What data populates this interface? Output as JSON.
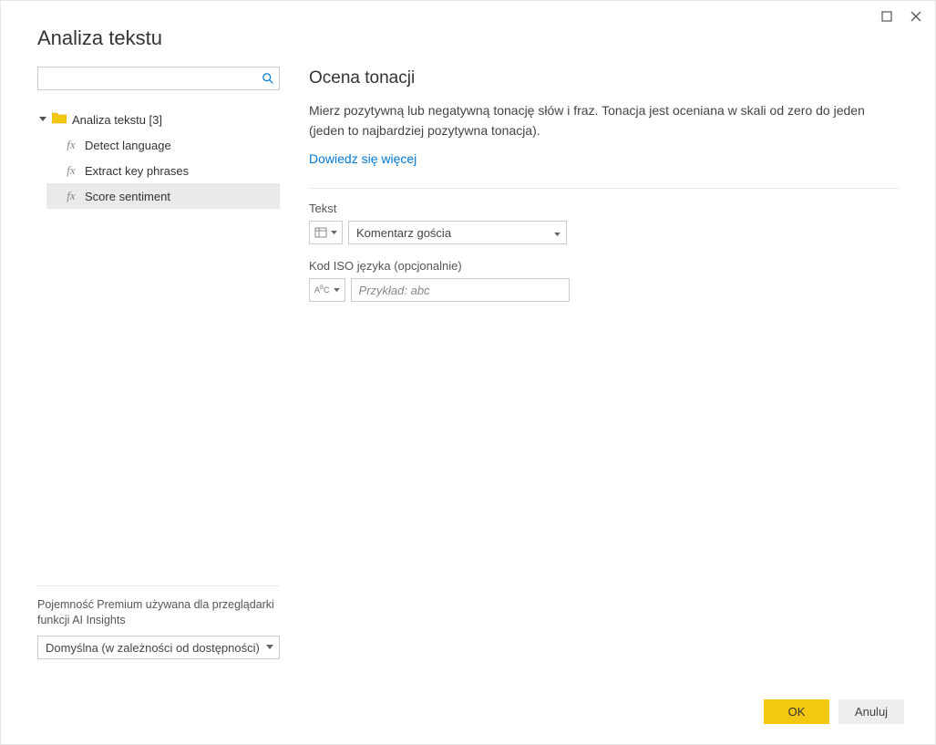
{
  "window": {
    "title": "Analiza tekstu"
  },
  "search": {
    "value": ""
  },
  "tree": {
    "root_label": "Analiza tekstu [3]",
    "items": [
      {
        "label": "Detect language",
        "selected": false
      },
      {
        "label": "Extract key phrases",
        "selected": false
      },
      {
        "label": "Score sentiment",
        "selected": true
      }
    ]
  },
  "capacity": {
    "label": "Pojemność Premium używana dla przeglądarki funkcji AI Insights",
    "value": "Domyślna (w zależności od dostępności)"
  },
  "details": {
    "heading": "Ocena tonacji",
    "description": "Mierz pozytywną lub negatywną tonację słów i fraz. Tonacja jest oceniana w skali od zero do jeden (jeden to najbardziej pozytywna tonacja).",
    "learn_more": "Dowiedz się więcej",
    "fields": {
      "text": {
        "label": "Tekst",
        "value": "Komentarz gościa"
      },
      "iso": {
        "label": "Kod ISO języka (opcjonalnie)",
        "placeholder": "Przykład: abc"
      }
    }
  },
  "buttons": {
    "ok": "OK",
    "cancel": "Anuluj"
  }
}
